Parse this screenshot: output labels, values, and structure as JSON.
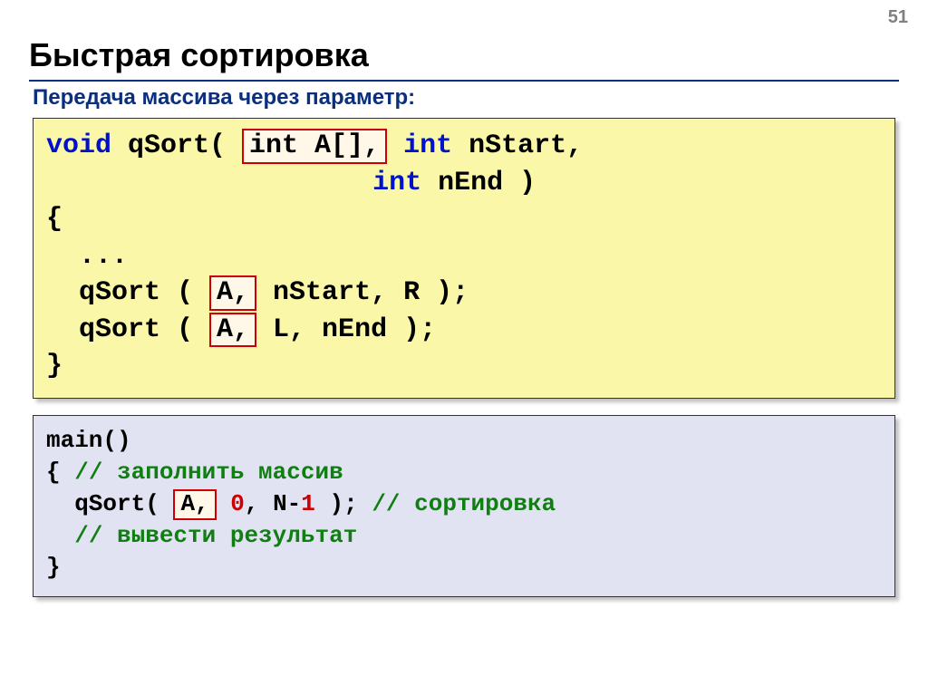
{
  "page_number": "51",
  "title": "Быстрая сортировка",
  "subtitle": "Передача массива через параметр:",
  "code1": {
    "kw_void": "void",
    "fn": " qSort( ",
    "hl_param": "int A[],",
    "sp1": " ",
    "kw_int1": "int",
    "p1": " nStart,",
    "indent2": "                    ",
    "kw_int2": "int",
    "p2": " nEnd )",
    "brace_open": "{",
    "dots": "  ...",
    "call1a": "  qSort ( ",
    "hl_a1": "A,",
    "call1b": " nStart, R );",
    "call2a": "  qSort ( ",
    "hl_a2": "A,",
    "call2b": " L, nEnd );",
    "brace_close": "}"
  },
  "code2": {
    "l1": "main()",
    "l2a": "{ ",
    "c1": "// заполнить массив",
    "l3a": "  qSort( ",
    "hl_a": "A,",
    "l3b": " ",
    "arg0": "0",
    "l3c": ", N-",
    "arg1": "1",
    "l3d": " ); ",
    "c2": "// сортировка",
    "l4a": "  ",
    "c3": "// вывести результат",
    "l5": "}"
  }
}
